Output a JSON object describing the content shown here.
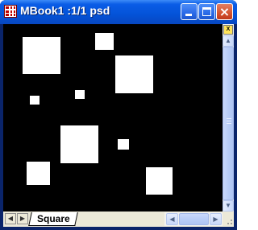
{
  "window": {
    "title": "MBook1 :1/1 psd"
  },
  "title_buttons": {
    "minimize": "minimize",
    "maximize": "maximize",
    "close": "×"
  },
  "colors": {
    "plot_background": "#000000",
    "square_fill": "#ffffff",
    "titlebar": "#0453d8"
  },
  "scrollbar": {
    "tool_icon_text": "X"
  },
  "sheet_tabs": [
    {
      "label": "Square",
      "active": true
    }
  ],
  "icons": {
    "nav_prev": "◀",
    "nav_next": "▶",
    "scroll_up": "▲",
    "scroll_down": "▼",
    "scroll_left": "◀",
    "scroll_right": "▶"
  }
}
